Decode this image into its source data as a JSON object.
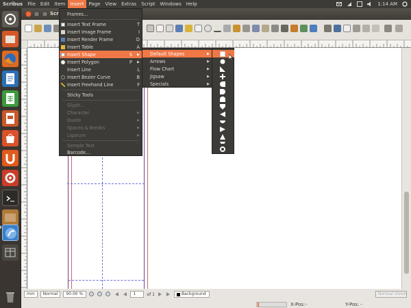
{
  "topbar": {
    "app": "Scribus",
    "menus": [
      "File",
      "Edit",
      "Item",
      "Insert",
      "Page",
      "View",
      "Extras",
      "Script",
      "Windows",
      "Help"
    ],
    "clock": "1:14 AM"
  },
  "window": {
    "title": "Scrib"
  },
  "status": {
    "unit": "mm",
    "mode": "Normal",
    "zoom": "90.00 %",
    "page": "1",
    "page_of": "of 1",
    "layer": "Background",
    "view": "Normal Vision"
  },
  "bottom": {
    "xpos": "X-Pos:",
    "xval": "-",
    "ypos": "Y-Pos:",
    "yval": "-"
  },
  "insert_menu": {
    "items": [
      {
        "label": "Frames...",
        "short": "",
        "icon": ""
      },
      {
        "label": "Insert Text Frame",
        "short": "T",
        "icon": "text-frame-icon"
      },
      {
        "label": "Insert Image Frame",
        "short": "I",
        "icon": "image-frame-icon"
      },
      {
        "label": "Insert Render Frame",
        "short": "D",
        "icon": "render-frame-icon"
      },
      {
        "label": "Insert Table",
        "short": "A",
        "icon": "table-icon"
      },
      {
        "label": "Insert Shape",
        "short": "S",
        "icon": "shape-icon"
      },
      {
        "label": "Insert Polygon",
        "short": "P",
        "icon": "polygon-icon"
      },
      {
        "label": "Insert Line",
        "short": "L",
        "icon": ""
      },
      {
        "label": "Insert Bezier Curve",
        "short": "B",
        "icon": "bezier-icon"
      },
      {
        "label": "Insert Freehand Line",
        "short": "F",
        "icon": "freehand-icon"
      },
      {
        "label": "Sticky Tools",
        "short": "",
        "icon": ""
      },
      {
        "label": "Glyph...",
        "short": "",
        "icon": ""
      },
      {
        "label": "Character",
        "short": "",
        "icon": ""
      },
      {
        "label": "Quote",
        "short": "",
        "icon": ""
      },
      {
        "label": "Spaces & Breaks",
        "short": "",
        "icon": ""
      },
      {
        "label": "Ligature",
        "short": "",
        "icon": ""
      },
      {
        "label": "Sample Text",
        "short": "",
        "icon": ""
      },
      {
        "label": "Barcode...",
        "short": "",
        "icon": ""
      }
    ]
  },
  "shape_menu": {
    "items": [
      "Default Shapes",
      "Arrows",
      "Flow Chart",
      "Jigsaw",
      "Specials"
    ]
  },
  "default_shapes": {
    "items": [
      "square-shape-icon",
      "circle-shape-icon",
      "triangle-corner-shape-icon",
      "cross-shape-icon",
      "half-circle-shape-icon",
      "bullet-shape-icon",
      "arch-shape-icon",
      "pentagon-down-shape-icon",
      "triangle-left-shape-icon",
      "semi-circle-shape-icon",
      "triangle-right-shape-icon",
      "triangle-up-shape-icon",
      "triangle-down-shape-icon",
      "octagon-shape-icon",
      "ring-shape-icon"
    ]
  },
  "colors": {
    "accent": "#f07746",
    "panel": "#3c3b37",
    "guide": "#6d6fd6",
    "page_edge": "#7a3b8e"
  }
}
